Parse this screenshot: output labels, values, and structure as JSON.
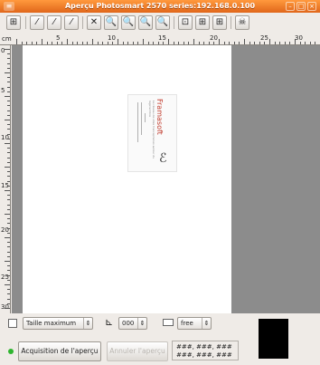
{
  "window": {
    "title": "Aperçu Photosmart 2570 series:192.168.0.100",
    "menu_glyph": "≡",
    "minimize": "–",
    "maximize": "□",
    "close": "×"
  },
  "toolbar": {
    "buttons": [
      {
        "name": "zoom-selection",
        "glyph": "⊞"
      },
      {
        "name": "pipette-white",
        "glyph": "⁄"
      },
      {
        "name": "pipette-gray",
        "glyph": "⁄"
      },
      {
        "name": "pipette-black",
        "glyph": "⁄"
      },
      {
        "name": "auto-normalize",
        "glyph": "✕"
      },
      {
        "name": "zoom-in",
        "glyph": "🔍"
      },
      {
        "name": "zoom-out",
        "glyph": "🔍"
      },
      {
        "name": "zoom-fit",
        "glyph": "🔍"
      },
      {
        "name": "zoom-undo",
        "glyph": "🔍"
      },
      {
        "name": "zoom-default",
        "glyph": "⊡"
      },
      {
        "name": "autoselect",
        "glyph": "⊞"
      },
      {
        "name": "select-all",
        "glyph": "⊞"
      },
      {
        "name": "close-preview",
        "glyph": "☠"
      }
    ]
  },
  "ruler": {
    "unit": "cm",
    "h_labels": [
      "5",
      "10",
      "15",
      "20",
      "25",
      "30"
    ],
    "v_labels": [
      "0",
      "5",
      "10",
      "15",
      "20",
      "25",
      "30"
    ]
  },
  "scan": {
    "card_brand": "Framasoft",
    "card_tagline": "Le réseau de sites francophones autour du logiciel libre",
    "card_logo": "ℰ"
  },
  "bottom": {
    "size_select": "Taille maximum",
    "angle_value": "000",
    "ratio_select": "free",
    "acquire_button": "Acquisition de l'aperçu",
    "cancel_button": "Annuler l'aperçu",
    "coords_line1": "###, ###, ###",
    "coords_line2": "###, ###, ###",
    "angle_icon": "⊾",
    "select_arrow": "⇕"
  },
  "colors": {
    "titlebar": "#e0661a",
    "preview_bg": "#8c8c8c",
    "status_ok": "#2fb52f"
  }
}
